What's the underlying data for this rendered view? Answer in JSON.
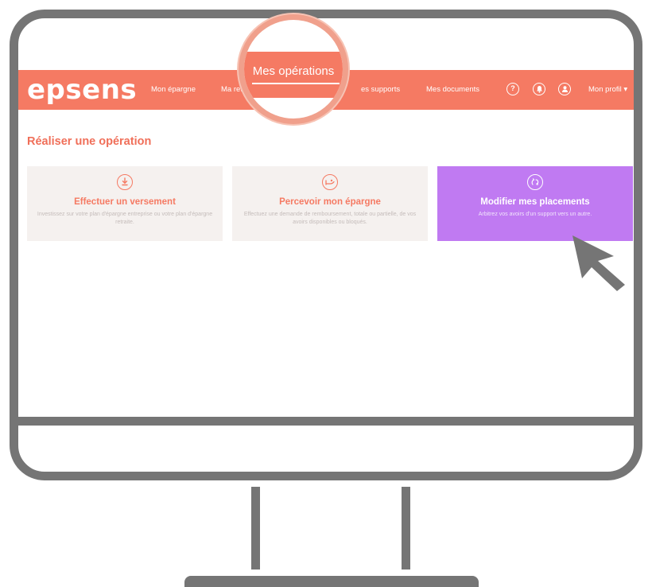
{
  "app": {
    "logo": "epsens"
  },
  "nav": {
    "items": [
      {
        "label": "Mon épargne"
      },
      {
        "label": "Ma retrai"
      },
      {
        "label": "es supports"
      },
      {
        "label": "Mes documents"
      }
    ],
    "icons": [
      "help-icon",
      "bell-icon",
      "user-icon"
    ],
    "help_glyph": "?",
    "profile_label": "Mon profil",
    "profile_caret": "▾",
    "magnified_label": "Mes opérations"
  },
  "page": {
    "title": "Réaliser une opération"
  },
  "cards": [
    {
      "title": "Effectuer un versement",
      "description": "Investissez sur votre plan d'épargne entreprise ou votre plan d'épargne retraite.",
      "icon": "download-icon"
    },
    {
      "title": "Percevoir mon épargne",
      "description": "Effectuez une demande de remboursement, totale ou partielle, de vos avoirs disponibles ou bloqués.",
      "icon": "receive-money-icon"
    },
    {
      "title": "Modifier mes placements",
      "description": "Arbitrez vos avoirs d'un support vers un autre.",
      "icon": "arbitrage-icon",
      "active": true
    }
  ],
  "colors": {
    "brand": "#f57a63",
    "active_card": "#c07af2",
    "frame": "#757575"
  }
}
